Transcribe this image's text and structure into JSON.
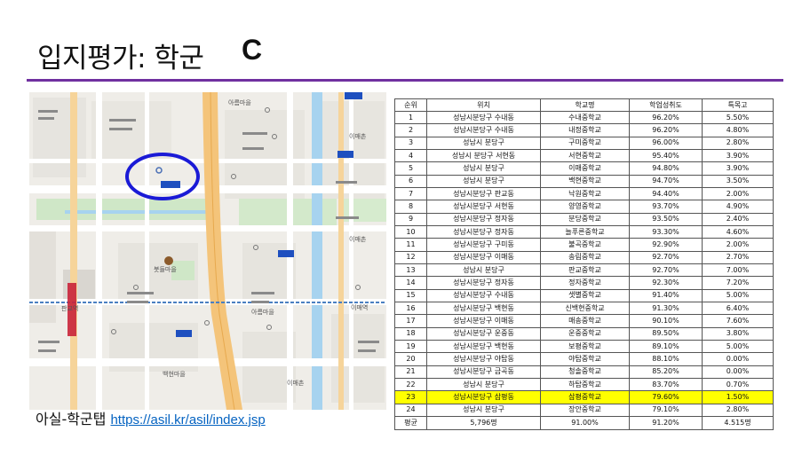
{
  "slide": {
    "title": "입지평가: 학군",
    "grade": "C"
  },
  "map": {
    "labels": [
      "아름마을",
      "이매촌",
      "봇들마을",
      "백현마을",
      "이매역",
      "판교역"
    ]
  },
  "caption": {
    "prefix": "아실-학군탭 ",
    "link": "https://asil.kr/asil/index.jsp"
  },
  "table": {
    "headers": [
      "순위",
      "위치",
      "학교명",
      "학업성취도",
      "특목고"
    ],
    "rows": [
      [
        "1",
        "성남시분당구 수내동",
        "수내중학교",
        "96.20%",
        "5.50%"
      ],
      [
        "2",
        "성남시분당구 수내동",
        "내정중학교",
        "96.20%",
        "4.80%"
      ],
      [
        "3",
        "성남시 분당구",
        "구미중학교",
        "96.00%",
        "2.80%"
      ],
      [
        "4",
        "성남시 분당구 서현동",
        "서현중학교",
        "95.40%",
        "3.90%"
      ],
      [
        "5",
        "성남시 분당구",
        "이매중학교",
        "94.80%",
        "3.90%"
      ],
      [
        "6",
        "성남시 분당구",
        "백현중학교",
        "94.70%",
        "3.50%"
      ],
      [
        "7",
        "성남시분당구 판교동",
        "낙원중학교",
        "94.40%",
        "2.00%"
      ],
      [
        "8",
        "성남시분당구 서현동",
        "양영중학교",
        "93.70%",
        "4.90%"
      ],
      [
        "9",
        "성남시분당구 정자동",
        "분당중학교",
        "93.50%",
        "2.40%"
      ],
      [
        "10",
        "성남시분당구 정자동",
        "늘푸른중학교",
        "93.30%",
        "4.60%"
      ],
      [
        "11",
        "성남시분당구 구미동",
        "불곡중학교",
        "92.90%",
        "2.00%"
      ],
      [
        "12",
        "성남시분당구 이매동",
        "송림중학교",
        "92.70%",
        "2.70%"
      ],
      [
        "13",
        "성남시 분당구",
        "판교중학교",
        "92.70%",
        "7.00%"
      ],
      [
        "14",
        "성남시분당구 정자동",
        "정자중학교",
        "92.30%",
        "7.20%"
      ],
      [
        "15",
        "성남시분당구 수내동",
        "샛별중학교",
        "91.40%",
        "5.00%"
      ],
      [
        "16",
        "성남시분당구 백현동",
        "신백현중학교",
        "91.30%",
        "6.40%"
      ],
      [
        "17",
        "성남시분당구 이매동",
        "매송중학교",
        "90.10%",
        "7.60%"
      ],
      [
        "18",
        "성남시분당구 운중동",
        "운중중학교",
        "89.50%",
        "3.80%"
      ],
      [
        "19",
        "성남시분당구 백현동",
        "보평중학교",
        "89.10%",
        "5.00%"
      ],
      [
        "20",
        "성남시분당구 야탑동",
        "야탑중학교",
        "88.10%",
        "0.00%"
      ],
      [
        "21",
        "성남시분당구 금곡동",
        "청솔중학교",
        "85.20%",
        "0.00%"
      ],
      [
        "22",
        "성남시 분당구",
        "하탑중학교",
        "83.70%",
        "0.70%"
      ],
      [
        "23",
        "성남시분당구 삼평동",
        "삼평중학교",
        "79.60%",
        "1.50%"
      ],
      [
        "24",
        "성남시 분당구",
        "장안중학교",
        "79.10%",
        "2.80%"
      ]
    ],
    "highlight_row_index": 22,
    "highlight_color": "#ffff00",
    "average": [
      "평균",
      "5,796명",
      "91.00%",
      "91.20%",
      "4.515명"
    ]
  },
  "colors": {
    "rule": "#7030a0",
    "circle": "#1a1ad6",
    "link": "#0563c1"
  }
}
